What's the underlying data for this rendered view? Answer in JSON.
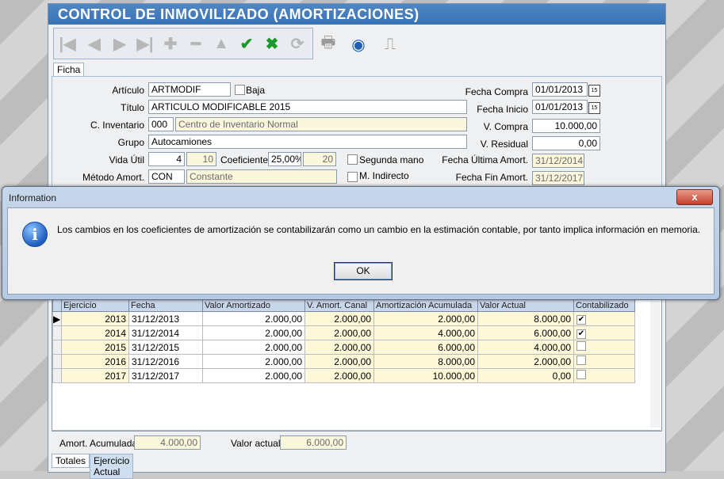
{
  "window": {
    "title": "CONTROL DE INMOVILIZADO (AMORTIZACIONES)"
  },
  "toolbar": {
    "icons": [
      "first-icon",
      "prev-icon",
      "next-icon",
      "last-icon",
      "add-icon",
      "remove-icon",
      "up-icon",
      "confirm-icon",
      "cancel-icon",
      "refresh-icon",
      "print-icon",
      "network-icon",
      "exit-icon"
    ]
  },
  "tabs": {
    "ficha": "Ficha"
  },
  "form": {
    "articulo_label": "Artículo",
    "articulo": "ARTMODIF",
    "baja_label": "Baja",
    "titulo_label": "Título",
    "titulo": "ARTICULO MODIFICABLE 2015",
    "inventario_label": "C. Inventario",
    "inventario_code": "000",
    "inventario_name": "Centro de Inventario Normal",
    "grupo_label": "Grupo",
    "grupo": "Autocamiones",
    "vida_label": "Vida Útil",
    "vida": "4",
    "vida2": "10",
    "coef_label": "Coeficiente",
    "coef": "25,00%",
    "coef2": "20",
    "segunda_label": "Segunda mano",
    "metodo_label": "Método Amort.",
    "metodo_code": "CON",
    "metodo_name": "Constante",
    "mindirecto_label": "M. Indirecto",
    "fcompra_label": "Fecha Compra",
    "fcompra": "01/01/2013",
    "finicio_label": "Fecha Inicio",
    "finicio": "01/01/2013",
    "vcompra_label": "V. Compra",
    "vcompra": "10.000,00",
    "vresidual_label": "V. Residual",
    "vresidual": "0,00",
    "fultima_label": "Fecha Última Amort.",
    "fultima": "31/12/2014",
    "ffin_label": "Fecha Fin Amort.",
    "ffin": "31/12/2017",
    "date_btn": "15"
  },
  "grid": {
    "headers": [
      "Ejercicio",
      "Fecha",
      "Valor Amortizado",
      "V. Amort. Canal",
      "Amortización Acumulada",
      "Valor Actual",
      "Contabilizado"
    ],
    "rows": [
      {
        "ejercicio": "2013",
        "fecha": "31/12/2013",
        "amortizado": "2.000,00",
        "canal": "2.000,00",
        "acumulada": "2.000,00",
        "actual": "8.000,00",
        "contabilizado": true
      },
      {
        "ejercicio": "2014",
        "fecha": "31/12/2014",
        "amortizado": "2.000,00",
        "canal": "2.000,00",
        "acumulada": "4.000,00",
        "actual": "6.000,00",
        "contabilizado": true
      },
      {
        "ejercicio": "2015",
        "fecha": "31/12/2015",
        "amortizado": "2.000,00",
        "canal": "2.000,00",
        "acumulada": "6.000,00",
        "actual": "4.000,00",
        "contabilizado": false
      },
      {
        "ejercicio": "2016",
        "fecha": "31/12/2016",
        "amortizado": "2.000,00",
        "canal": "2.000,00",
        "acumulada": "8.000,00",
        "actual": "2.000,00",
        "contabilizado": false
      },
      {
        "ejercicio": "2017",
        "fecha": "31/12/2017",
        "amortizado": "2.000,00",
        "canal": "2.000,00",
        "acumulada": "10.000,00",
        "actual": "0,00",
        "contabilizado": false
      }
    ]
  },
  "footer": {
    "acum_label": "Amort. Acumulada",
    "acum": "4.000,00",
    "actual_label": "Valor actual",
    "actual": "6.000,00"
  },
  "bottom_tabs": {
    "totales": "Totales",
    "ejercicio": "Ejercicio Actual"
  },
  "dialog": {
    "title": "Information",
    "close": "x",
    "icon": "i",
    "message": "Los cambios en los coeficientes de amortización se contabilizarán como un cambio en la estimación contable, por tanto implica información en memoria.",
    "ok": "OK"
  }
}
